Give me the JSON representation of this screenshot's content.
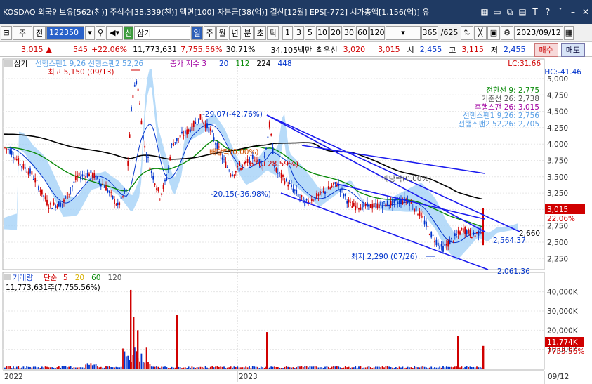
{
  "window": {
    "title": "KOSDAQ 외국인보유[562(천)] 주식수[38,339(천)] 액면[100] 자본금[38(억)] 결산[12월] EPS[-772] 시가총액[1,156(억)] 유",
    "icons": [
      "calc-icon",
      "window-icon",
      "copy-icon",
      "grid-icon",
      "text-icon",
      "help-icon",
      "pin-icon",
      "minimize-icon",
      "close-icon"
    ]
  },
  "toolbar": {
    "market": "주",
    "all": "전",
    "code": "122350",
    "shin": "신",
    "name": "삼기",
    "periods": [
      "일",
      "주",
      "월",
      "년",
      "분",
      "초",
      "틱"
    ],
    "minutes": [
      "1",
      "3",
      "5",
      "10",
      "20",
      "30",
      "60",
      "120"
    ],
    "count": "365",
    "total": "/625",
    "date": "2023/09/12"
  },
  "infobar": {
    "price": "3,015",
    "change": "545",
    "change_pct": "+22.06%",
    "volume": "11,773,631",
    "volume_pct": "7,755.56%",
    "turnover": "30.71%",
    "amount": "34,105백만",
    "priority_label": "최우선",
    "priority_price": "3,020",
    "ask": "3,015",
    "open_label": "시",
    "open": "2,455",
    "high_label": "고",
    "high": "3,115",
    "low_label": "저",
    "low": "2,455",
    "buy_label": "매수",
    "sell_label": "매도"
  },
  "price_panel": {
    "stock_label": "삼기",
    "ichimoku_legend": "선행스팬1 9,26  선행스팬2 52,26",
    "close_legend": "종가 지수 3",
    "ma_legend": [
      "20",
      "112",
      "224",
      "448"
    ],
    "ma_colors": [
      "#0033cc",
      "#0a8a0a",
      "#000000",
      "#0033cc"
    ],
    "lc": "LC:31.66",
    "hc": "HC:-41.46",
    "high_annotation": "최고 5,150 (09/13)",
    "low_annotation": "최저 2,290 (07/26)",
    "ichimoku_values": [
      {
        "label": "전환선 9: 2,775",
        "color": "#0a8a0a"
      },
      {
        "label": "기준선 26: 2,738",
        "color": "#555555"
      },
      {
        "label": "후행스팬 26: 3,015",
        "color": "#a000a0"
      },
      {
        "label": "선행스팬1 9,26: 2,756",
        "color": "#5aa0e6"
      },
      {
        "label": "선행스팬2 52,26: 2,705",
        "color": "#5aa0e6"
      }
    ],
    "annotations": [
      "-29.07(-42.76%)",
      "배당락(0.00%)",
      "17.67(+28.59%)",
      "-20.15(-36.98%)",
      "배당락(0.00%)"
    ],
    "trend_labels": [
      "2,660",
      "2,564.37",
      "2,061.36"
    ],
    "current_price": "3,015",
    "current_pct": "22.06%",
    "ylim": [
      2000,
      5150
    ],
    "yticks": [
      "5,000",
      "4,750",
      "4,500",
      "4,250",
      "4,000",
      "3,750",
      "3,500",
      "3,250",
      "3,000",
      "2,750",
      "2,500",
      "2,250"
    ]
  },
  "volume_panel": {
    "legend_title": "거래량",
    "legend_type": "단순",
    "ma_periods": [
      "5",
      "20",
      "60",
      "120"
    ],
    "ma_colors": [
      "#d00000",
      "#d7b000",
      "#0a8a0a",
      "#555555"
    ],
    "volume_text": "11,773,631주(7,755.56%)",
    "current": "11,774K",
    "current_pct": "7755.56%",
    "yticks": [
      "40,000K",
      "30,000K",
      "20,000K",
      "10,000K"
    ]
  },
  "xaxis": {
    "labels": [
      "2022",
      "2023",
      "09/12"
    ]
  },
  "colors": {
    "up": "#d00000",
    "down": "#0033cc",
    "cloud": "#9fcff7",
    "title_bg": "#1f3a63"
  }
}
